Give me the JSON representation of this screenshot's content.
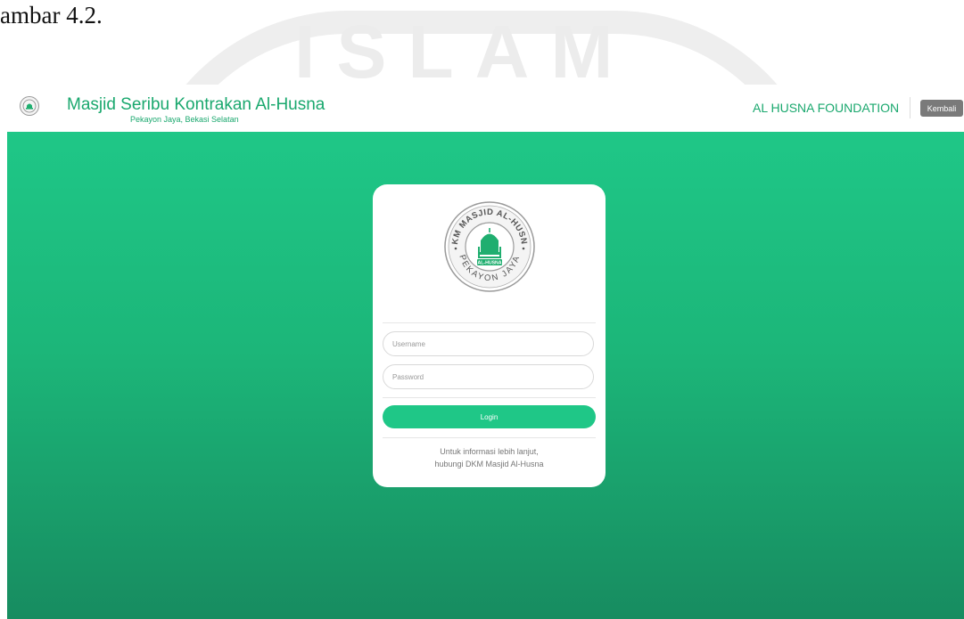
{
  "document": {
    "caption_fragment": "ambar 4.2.",
    "watermark_text": "ISLAM"
  },
  "header": {
    "title": "Masjid Seribu Kontrakan Al-Husna",
    "subtitle": "Pekayon Jaya, Bekasi Selatan",
    "foundation_link": "AL HUSNA FOUNDATION",
    "back_label": "Kembali",
    "logo_icon": "mosque-emblem-icon"
  },
  "login": {
    "emblem": {
      "top_text": "DKM MASJID AL-HUSNA",
      "bottom_text": "PEKAYON JAYA",
      "inner_text": "AL-HUSNA",
      "icon": "mosque-emblem-icon"
    },
    "username_placeholder": "Username",
    "password_placeholder": "Password",
    "login_label": "Login",
    "info_line1": "Untuk informasi lebih lanjut,",
    "info_line2": "hubungi DKM Masjid Al-Husna"
  },
  "colors": {
    "accent": "#1fc787",
    "accent_text": "#1aa86e",
    "gradient_bottom": "#178c60",
    "back_button": "#7a7a7a"
  }
}
